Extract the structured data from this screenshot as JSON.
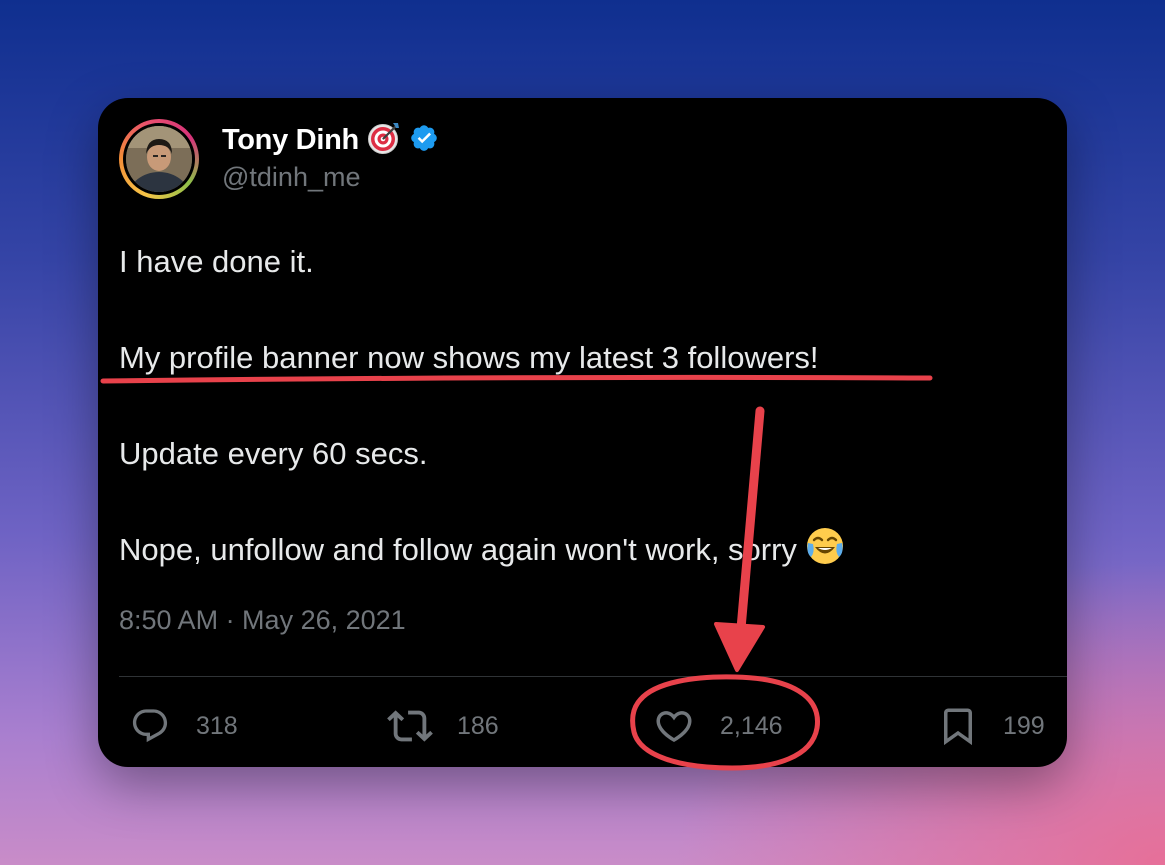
{
  "tweet": {
    "display_name": "Tony Dinh",
    "name_emoji": "🎯",
    "handle": "@tdinh_me",
    "lines": [
      "I have done it.",
      "My profile banner now shows my latest 3 followers!",
      "Update every 60 secs.",
      "Nope, unfollow and follow again won't work, sorry"
    ],
    "last_line_emoji": "face-with-tears-of-joy",
    "timestamp": "8:50 AM · May 26, 2021"
  },
  "actions": {
    "replies": "318",
    "retweets": "186",
    "likes": "2,146",
    "bookmarks": "199"
  },
  "icons": {
    "verified": "verified-badge-icon",
    "reply": "reply-icon",
    "retweet": "retweet-icon",
    "like": "heart-icon",
    "bookmark": "bookmark-icon"
  },
  "colors": {
    "card_background": "#000000",
    "text_primary": "#e7e9ea",
    "text_secondary": "#71767b",
    "verified_blue": "#1d9bf0",
    "annotation_red": "#e8424b"
  }
}
